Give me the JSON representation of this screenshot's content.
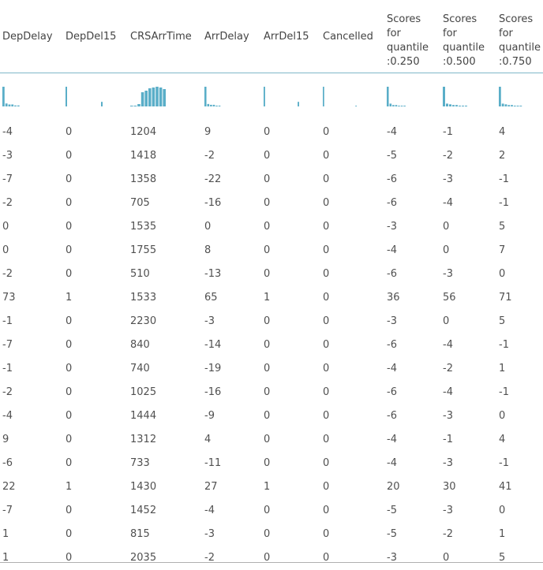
{
  "columns": [
    {
      "key": "DepDelay",
      "label": "DepDelay",
      "hist": [
        20,
        3,
        2,
        2,
        1,
        1,
        0,
        0,
        0
      ]
    },
    {
      "key": "DepDel15",
      "label": "DepDel15",
      "hist": [
        30,
        0,
        0,
        0,
        0,
        0,
        0,
        0,
        0,
        0,
        0,
        0,
        0,
        0,
        0,
        7
      ]
    },
    {
      "key": "CRSArrTime",
      "label": "CRSArrTime",
      "hist": [
        1,
        1,
        3,
        18,
        20,
        23,
        24,
        25,
        24,
        22
      ]
    },
    {
      "key": "ArrDelay",
      "label": "ArrDelay",
      "hist": [
        24,
        3,
        2,
        2,
        1,
        1,
        0,
        0,
        0
      ]
    },
    {
      "key": "ArrDel15",
      "label": "ArrDel15",
      "hist": [
        30,
        0,
        0,
        0,
        0,
        0,
        0,
        0,
        0,
        0,
        0,
        0,
        0,
        0,
        0,
        7
      ]
    },
    {
      "key": "Cancelled",
      "label": "Cancelled",
      "hist": [
        30,
        0,
        0,
        0,
        0,
        0,
        0,
        0,
        0,
        0,
        0,
        0,
        0,
        0,
        0,
        1
      ]
    },
    {
      "key": "q250",
      "label": "Scores\nfor\nquantile\n:0.250",
      "hist": [
        28,
        4,
        2,
        2,
        1,
        1,
        1,
        0,
        0
      ]
    },
    {
      "key": "q500",
      "label": "Scores\nfor\nquantile\n:0.500",
      "hist": [
        28,
        4,
        3,
        2,
        2,
        1,
        1,
        1,
        0
      ]
    },
    {
      "key": "q750",
      "label": "Scores\nfor\nquantile\n:0.750",
      "hist": [
        28,
        4,
        3,
        2,
        2,
        1,
        1,
        1,
        0
      ]
    }
  ],
  "rows": [
    [
      "-4",
      "0",
      "1204",
      "9",
      "0",
      "0",
      "-4",
      "-1",
      "4"
    ],
    [
      "-3",
      "0",
      "1418",
      "-2",
      "0",
      "0",
      "-5",
      "-2",
      "2"
    ],
    [
      "-7",
      "0",
      "1358",
      "-22",
      "0",
      "0",
      "-6",
      "-3",
      "-1"
    ],
    [
      "-2",
      "0",
      "705",
      "-16",
      "0",
      "0",
      "-6",
      "-4",
      "-1"
    ],
    [
      "0",
      "0",
      "1535",
      "0",
      "0",
      "0",
      "-3",
      "0",
      "5"
    ],
    [
      "0",
      "0",
      "1755",
      "8",
      "0",
      "0",
      "-4",
      "0",
      "7"
    ],
    [
      "-2",
      "0",
      "510",
      "-13",
      "0",
      "0",
      "-6",
      "-3",
      "0"
    ],
    [
      "73",
      "1",
      "1533",
      "65",
      "1",
      "0",
      "36",
      "56",
      "71"
    ],
    [
      "-1",
      "0",
      "2230",
      "-3",
      "0",
      "0",
      "-3",
      "0",
      "5"
    ],
    [
      "-7",
      "0",
      "840",
      "-14",
      "0",
      "0",
      "-6",
      "-4",
      "-1"
    ],
    [
      "-1",
      "0",
      "740",
      "-19",
      "0",
      "0",
      "-4",
      "-2",
      "1"
    ],
    [
      "-2",
      "0",
      "1025",
      "-16",
      "0",
      "0",
      "-6",
      "-4",
      "-1"
    ],
    [
      "-4",
      "0",
      "1444",
      "-9",
      "0",
      "0",
      "-6",
      "-3",
      "0"
    ],
    [
      "9",
      "0",
      "1312",
      "4",
      "0",
      "0",
      "-4",
      "-1",
      "4"
    ],
    [
      "-6",
      "0",
      "733",
      "-11",
      "0",
      "0",
      "-4",
      "-3",
      "-1"
    ],
    [
      "22",
      "1",
      "1430",
      "27",
      "1",
      "0",
      "20",
      "30",
      "41"
    ],
    [
      "-7",
      "0",
      "1452",
      "-4",
      "0",
      "0",
      "-5",
      "-3",
      "0"
    ],
    [
      "1",
      "0",
      "815",
      "-3",
      "0",
      "0",
      "-5",
      "-2",
      "1"
    ],
    [
      "1",
      "0",
      "2035",
      "-2",
      "0",
      "0",
      "-3",
      "0",
      "5"
    ]
  ],
  "colors": {
    "hist_bar": "#5aaec8",
    "header_rule": "#7fb8c8",
    "text": "#505050"
  }
}
